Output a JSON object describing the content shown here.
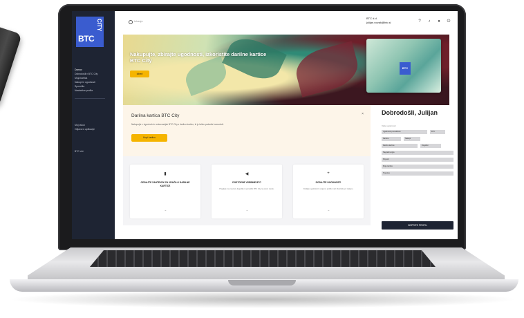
{
  "sidebar": {
    "logo": {
      "main": "BTC",
      "vertical": "CITY",
      "brand_color": "#3a5ccf"
    },
    "group_a": [
      "Domov",
      "Dobrodošli v BTC City",
      "Moja kartica",
      "Nakupi in ugodnosti",
      "Sporočila",
      "Nastavitve profila"
    ],
    "group_b": [
      "Moj račun",
      "Odjava iz aplikacije"
    ],
    "footer": "BTC d.d."
  },
  "topbar": {
    "search_placeholder": "Iskanje",
    "company_line1": "BTC d.d.",
    "company_line2": "julijan.novak@btc.si",
    "icons": [
      "question-icon",
      "bell-icon",
      "user-icon",
      "power-icon"
    ]
  },
  "hero": {
    "title": "Nakupujte, zbirajte ugodnosti, izkoristite darilne kartice BTC City",
    "button": "Izberi"
  },
  "panel": {
    "title": "Darilna kartica BTC City",
    "close": "×",
    "subtitle": "Nakupujte v trgovinah in restavracijah BTC City z darilno kartico, ki jo lahko podarite komurkoli.",
    "button": "Kupi kartico"
  },
  "cards": [
    {
      "icon": "▮",
      "title": "ODDAJTE ZAHTEVEK ZA VRAČILO DARILNE KARTICE",
      "desc": "",
      "arrow": "→"
    },
    {
      "icon": "◀",
      "title": "DOSTOPNE VSEBINE BTC",
      "desc": "Preglejte vse novosti, dogodke in ponudbo BTC City na enem mestu.",
      "arrow": "→"
    },
    {
      "icon": "+",
      "title": "DODAJTE UGODNOSTI",
      "desc": "Dodajte ugodnosti k svojemu profilu in jih izkoristite pri nakupu.",
      "arrow": "→"
    }
  ],
  "right": {
    "welcome": "Dobrodošli, Julijan",
    "section_label": "Vaše ugodnosti",
    "tags": [
      "Ugodnosti ponudnikov",
      "BTC",
      "Kartica",
      "Nakupi",
      "Darilne kartice",
      "Dogodki",
      "Nagradna igra",
      "Popusti",
      "Moje kartice",
      "Trgovine"
    ],
    "button": "ODPRITE PROFIL"
  }
}
